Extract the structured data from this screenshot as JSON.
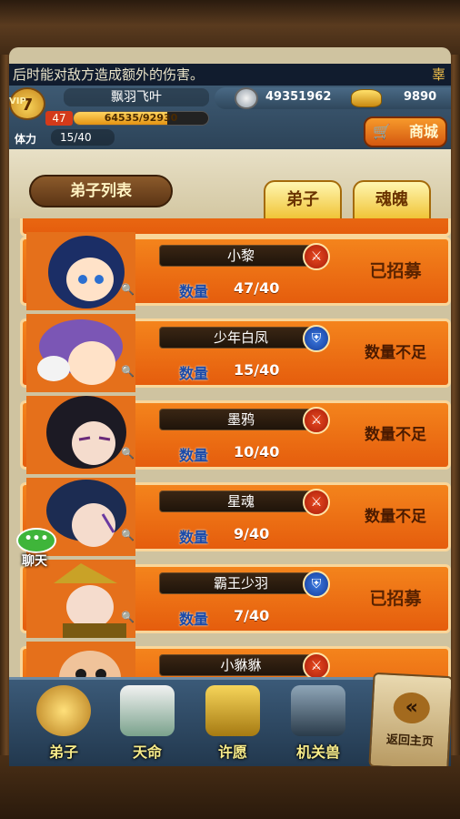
{
  "marquee": {
    "text": "后时能对敌方造成额外的伤害。",
    "tail": "辜"
  },
  "player": {
    "vip_label": "VIP",
    "vip_level": "7",
    "name": "飘羽飞叶",
    "level": "47",
    "exp_text": "64535/92930",
    "exp_fraction": 0.694,
    "stamina_label": "体力",
    "stamina_value": "15/40"
  },
  "currency": {
    "coin_icon": "coin-icon",
    "coins": "49351962",
    "gold_icon": "gold-ingot-icon",
    "gold": "9890"
  },
  "shop_button": {
    "label": "商城",
    "icon": "cart-icon"
  },
  "list_title": "弟子列表",
  "tabs": [
    {
      "label": "弟子",
      "active": false
    },
    {
      "label": "魂魄",
      "active": true
    }
  ],
  "qty_label": "数量",
  "disciples": [
    {
      "name": "小黎",
      "type": "sword-icon",
      "quantity": "47/40",
      "status": "已招募"
    },
    {
      "name": "少年白凤",
      "type": "shield-icon",
      "quantity": "15/40",
      "status": "数量不足"
    },
    {
      "name": "墨鸦",
      "type": "sword-icon",
      "quantity": "10/40",
      "status": "数量不足"
    },
    {
      "name": "星魂",
      "type": "sword-icon",
      "quantity": "9/40",
      "status": "数量不足"
    },
    {
      "name": "霸王少羽",
      "type": "shield-icon",
      "quantity": "7/40",
      "status": "已招募"
    },
    {
      "name": "小貅貅",
      "type": "sword-icon",
      "quantity": "",
      "status": ""
    }
  ],
  "chat": {
    "label": "聊天"
  },
  "nav": [
    {
      "label": "弟子"
    },
    {
      "label": "天命"
    },
    {
      "label": "许愿"
    },
    {
      "label": "机关兽"
    }
  ],
  "back_button": {
    "arrow": "«",
    "label": "返回主页"
  },
  "colors": {
    "card_orange": "#e55d0d",
    "card_border": "#f9d69a",
    "qty_blue": "#1b4aa8",
    "nav_label": "#f7ec8a"
  }
}
